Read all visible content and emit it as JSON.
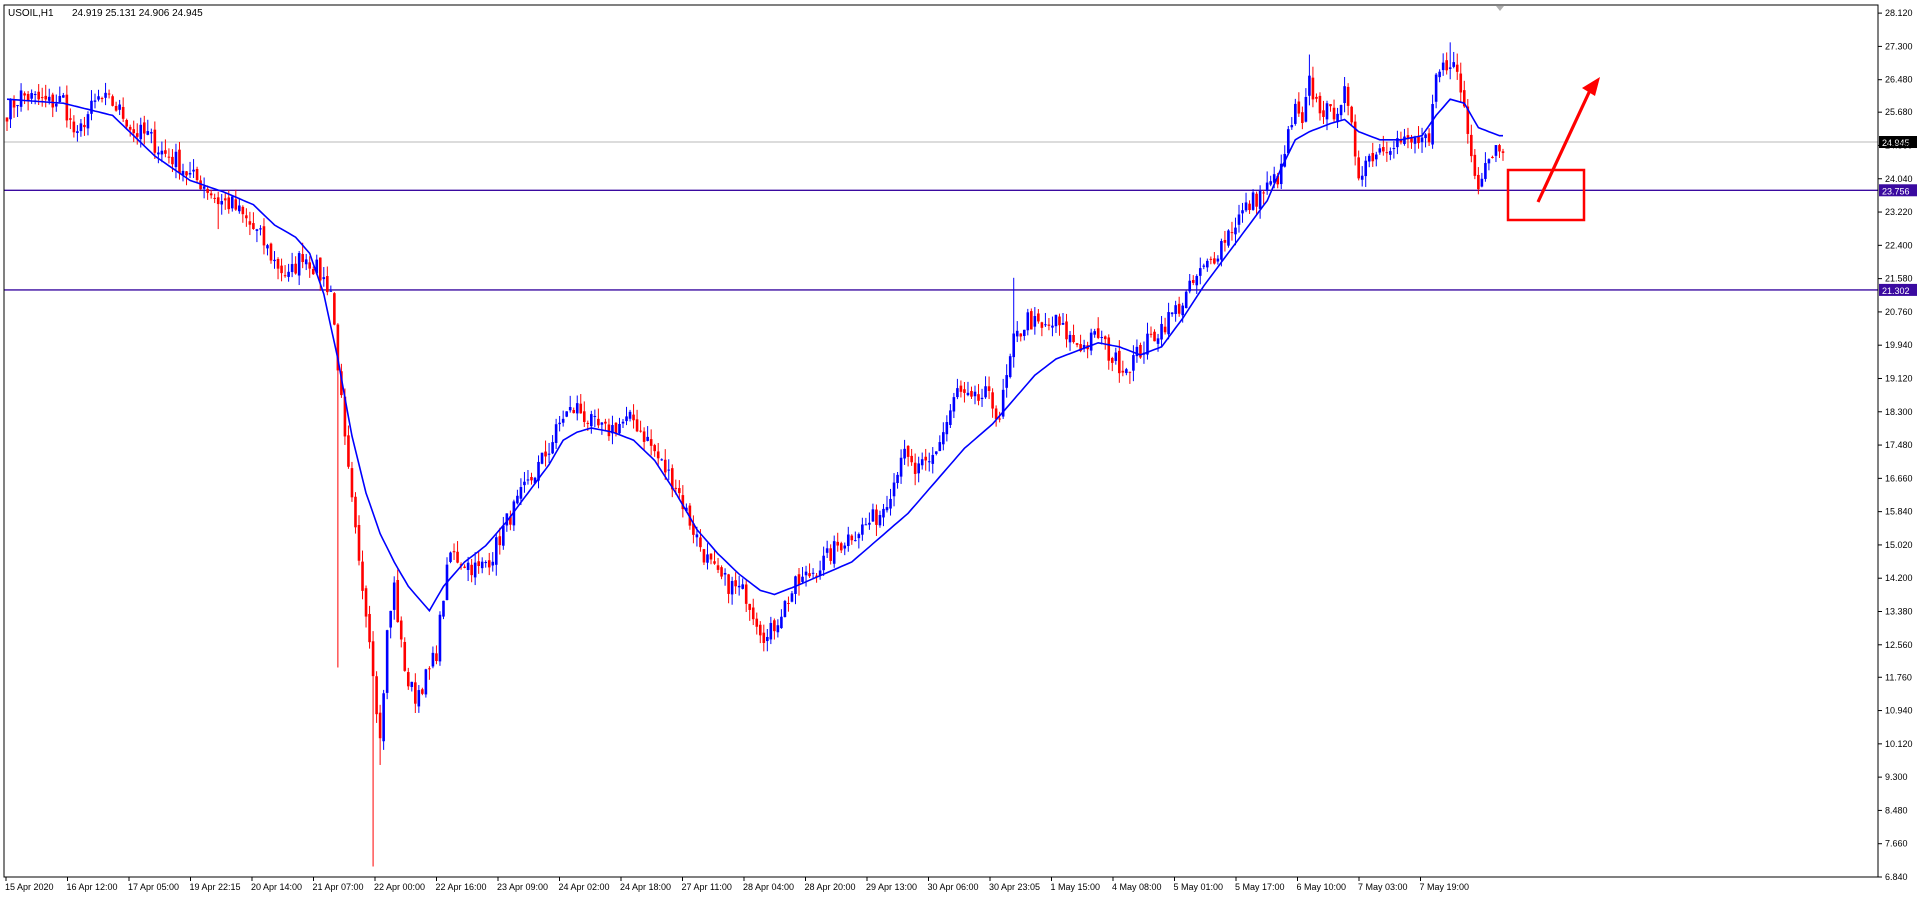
{
  "header": {
    "symbol": "USOIL,H1",
    "ohlc": "24.919 25.131 24.906 24.945"
  },
  "colors": {
    "background": "#ffffff",
    "bull": "#0000ff",
    "bear": "#ff0000",
    "ma": "#0000ff",
    "level_line": "#3a0aa0",
    "bid_line": "#b8b8b8",
    "annotation": "#ff0000",
    "frame": "#000000"
  },
  "chart_data": {
    "type": "candlestick",
    "title": "USOIL,H1",
    "xlabel": "",
    "ylabel": "",
    "ylim": [
      6.84,
      28.32
    ],
    "y_ticks": [
      "28.120",
      "27.300",
      "26.480",
      "25.680",
      "24.860",
      "24.040",
      "23.220",
      "22.400",
      "21.580",
      "20.760",
      "19.940",
      "19.120",
      "18.300",
      "17.480",
      "16.660",
      "15.840",
      "15.020",
      "14.200",
      "13.380",
      "12.560",
      "11.760",
      "10.940",
      "10.120",
      "9.300",
      "8.480",
      "7.660",
      "6.840"
    ],
    "x_ticks": [
      "15 Apr 2020",
      "16 Apr 12:00",
      "17 Apr 05:00",
      "19 Apr 22:15",
      "20 Apr 14:00",
      "21 Apr 07:00",
      "22 Apr 00:00",
      "22 Apr 16:00",
      "23 Apr 09:00",
      "24 Apr 02:00",
      "24 Apr 18:00",
      "27 Apr 11:00",
      "28 Apr 04:00",
      "28 Apr 20:00",
      "29 Apr 13:00",
      "30 Apr 06:00",
      "30 Apr 23:05",
      "1 May 15:00",
      "4 May 08:00",
      "5 May 01:00",
      "5 May 17:00",
      "6 May 10:00",
      "7 May 03:00",
      "7 May 19:00"
    ],
    "price_path": [
      [
        0,
        25.7
      ],
      [
        4,
        26.1
      ],
      [
        8,
        26.0
      ],
      [
        12,
        25.9
      ],
      [
        16,
        26.0
      ],
      [
        18,
        25.4
      ],
      [
        20,
        25.0
      ],
      [
        22,
        25.5
      ],
      [
        26,
        26.0
      ],
      [
        30,
        25.9
      ],
      [
        34,
        25.5
      ],
      [
        36,
        25.2
      ],
      [
        40,
        25.1
      ],
      [
        44,
        24.7
      ],
      [
        48,
        24.5
      ],
      [
        52,
        24.1
      ],
      [
        56,
        23.9
      ],
      [
        60,
        23.5
      ],
      [
        64,
        23.4
      ],
      [
        68,
        23.0
      ],
      [
        72,
        22.6
      ],
      [
        76,
        22.0
      ],
      [
        80,
        21.6
      ],
      [
        84,
        22.2
      ],
      [
        88,
        21.8
      ],
      [
        92,
        21.3
      ],
      [
        94,
        19.5
      ],
      [
        96,
        17.5
      ],
      [
        98,
        16.0
      ],
      [
        100,
        14.5
      ],
      [
        102,
        13.5
      ],
      [
        104,
        12.0
      ],
      [
        106,
        10.2
      ],
      [
        108,
        12.8
      ],
      [
        110,
        14.0
      ],
      [
        112,
        12.5
      ],
      [
        114,
        11.6
      ],
      [
        116,
        11.3
      ],
      [
        118,
        11.6
      ],
      [
        120,
        11.9
      ],
      [
        122,
        12.4
      ],
      [
        124,
        13.8
      ],
      [
        126,
        14.8
      ],
      [
        130,
        14.6
      ],
      [
        134,
        14.4
      ],
      [
        138,
        14.8
      ],
      [
        142,
        15.6
      ],
      [
        146,
        16.2
      ],
      [
        150,
        16.8
      ],
      [
        154,
        17.4
      ],
      [
        158,
        18.2
      ],
      [
        162,
        18.4
      ],
      [
        166,
        18.0
      ],
      [
        170,
        17.8
      ],
      [
        174,
        18.0
      ],
      [
        178,
        18.1
      ],
      [
        182,
        17.6
      ],
      [
        186,
        17.0
      ],
      [
        190,
        16.5
      ],
      [
        194,
        15.6
      ],
      [
        198,
        14.8
      ],
      [
        202,
        14.2
      ],
      [
        206,
        14.0
      ],
      [
        210,
        13.8
      ],
      [
        214,
        13.0
      ],
      [
        216,
        12.7
      ],
      [
        220,
        13.4
      ],
      [
        224,
        14.0
      ],
      [
        228,
        14.3
      ],
      [
        232,
        14.6
      ],
      [
        236,
        15.0
      ],
      [
        240,
        15.3
      ],
      [
        244,
        15.5
      ],
      [
        248,
        15.8
      ],
      [
        252,
        16.6
      ],
      [
        254,
        17.3
      ],
      [
        258,
        16.8
      ],
      [
        262,
        17.0
      ],
      [
        266,
        17.8
      ],
      [
        270,
        18.8
      ],
      [
        274,
        18.5
      ],
      [
        278,
        18.7
      ],
      [
        282,
        18.2
      ],
      [
        286,
        20.0
      ],
      [
        290,
        20.6
      ],
      [
        294,
        20.3
      ],
      [
        298,
        20.5
      ],
      [
        302,
        20.1
      ],
      [
        306,
        19.9
      ],
      [
        310,
        20.2
      ],
      [
        314,
        19.6
      ],
      [
        318,
        19.4
      ],
      [
        322,
        19.8
      ],
      [
        326,
        20.2
      ],
      [
        330,
        20.6
      ],
      [
        334,
        21.0
      ],
      [
        338,
        21.6
      ],
      [
        342,
        22.0
      ],
      [
        346,
        22.6
      ],
      [
        350,
        23.1
      ],
      [
        354,
        23.5
      ],
      [
        358,
        23.8
      ],
      [
        362,
        24.2
      ],
      [
        364,
        25.1
      ],
      [
        366,
        25.7
      ],
      [
        368,
        25.3
      ],
      [
        370,
        26.4
      ],
      [
        372,
        25.9
      ],
      [
        376,
        25.6
      ],
      [
        380,
        26.1
      ],
      [
        382,
        25.2
      ],
      [
        384,
        24.2
      ],
      [
        386,
        24.5
      ],
      [
        390,
        24.8
      ],
      [
        394,
        25.0
      ],
      [
        398,
        24.9
      ],
      [
        402,
        25.0
      ],
      [
        404,
        24.8
      ],
      [
        406,
        26.5
      ],
      [
        410,
        27.0
      ],
      [
        412,
        26.6
      ],
      [
        414,
        25.8
      ],
      [
        416,
        24.6
      ],
      [
        418,
        24.0
      ],
      [
        420,
        24.5
      ],
      [
        424,
        24.9
      ]
    ],
    "moving_average": [
      [
        0,
        26.0
      ],
      [
        16,
        25.9
      ],
      [
        30,
        25.6
      ],
      [
        42,
        24.6
      ],
      [
        52,
        24.0
      ],
      [
        62,
        23.7
      ],
      [
        70,
        23.4
      ],
      [
        76,
        22.9
      ],
      [
        82,
        22.6
      ],
      [
        86,
        22.2
      ],
      [
        90,
        21.2
      ],
      [
        94,
        19.6
      ],
      [
        98,
        17.7
      ],
      [
        102,
        16.3
      ],
      [
        106,
        15.3
      ],
      [
        110,
        14.6
      ],
      [
        114,
        14.0
      ],
      [
        118,
        13.6
      ],
      [
        120,
        13.4
      ],
      [
        124,
        14.0
      ],
      [
        130,
        14.6
      ],
      [
        136,
        15.0
      ],
      [
        142,
        15.6
      ],
      [
        148,
        16.3
      ],
      [
        154,
        17.0
      ],
      [
        158,
        17.6
      ],
      [
        162,
        17.8
      ],
      [
        166,
        17.9
      ],
      [
        172,
        17.8
      ],
      [
        178,
        17.6
      ],
      [
        184,
        17.1
      ],
      [
        190,
        16.3
      ],
      [
        196,
        15.4
      ],
      [
        202,
        14.8
      ],
      [
        208,
        14.3
      ],
      [
        214,
        13.9
      ],
      [
        218,
        13.8
      ],
      [
        224,
        14.0
      ],
      [
        232,
        14.3
      ],
      [
        240,
        14.6
      ],
      [
        248,
        15.2
      ],
      [
        256,
        15.8
      ],
      [
        264,
        16.6
      ],
      [
        272,
        17.4
      ],
      [
        280,
        18.0
      ],
      [
        286,
        18.6
      ],
      [
        292,
        19.2
      ],
      [
        298,
        19.6
      ],
      [
        304,
        19.8
      ],
      [
        310,
        20.0
      ],
      [
        316,
        19.9
      ],
      [
        322,
        19.7
      ],
      [
        328,
        19.9
      ],
      [
        334,
        20.6
      ],
      [
        340,
        21.4
      ],
      [
        346,
        22.1
      ],
      [
        352,
        22.8
      ],
      [
        358,
        23.5
      ],
      [
        362,
        24.3
      ],
      [
        366,
        25.0
      ],
      [
        370,
        25.2
      ],
      [
        376,
        25.4
      ],
      [
        380,
        25.5
      ],
      [
        384,
        25.2
      ],
      [
        390,
        25.0
      ],
      [
        396,
        25.0
      ],
      [
        402,
        25.1
      ],
      [
        406,
        25.6
      ],
      [
        410,
        26.0
      ],
      [
        414,
        25.9
      ],
      [
        418,
        25.3
      ],
      [
        424,
        25.1
      ]
    ],
    "wick_extremes": [
      {
        "i": 104,
        "low": 7.1
      },
      {
        "i": 94,
        "low": 12.0
      },
      {
        "i": 106,
        "low": 9.6
      },
      {
        "i": 216,
        "low": 12.4
      },
      {
        "i": 318,
        "low": 19.2
      },
      {
        "i": 410,
        "high": 27.4
      },
      {
        "i": 370,
        "high": 27.1
      },
      {
        "i": 286,
        "high": 21.6
      },
      {
        "i": 60,
        "low": 22.8
      }
    ],
    "horizontal_levels": [
      23.756,
      21.302
    ],
    "level_labels": [
      "23.756",
      "21.302"
    ],
    "current_price": 24.945,
    "current_price_label": "24.945"
  }
}
